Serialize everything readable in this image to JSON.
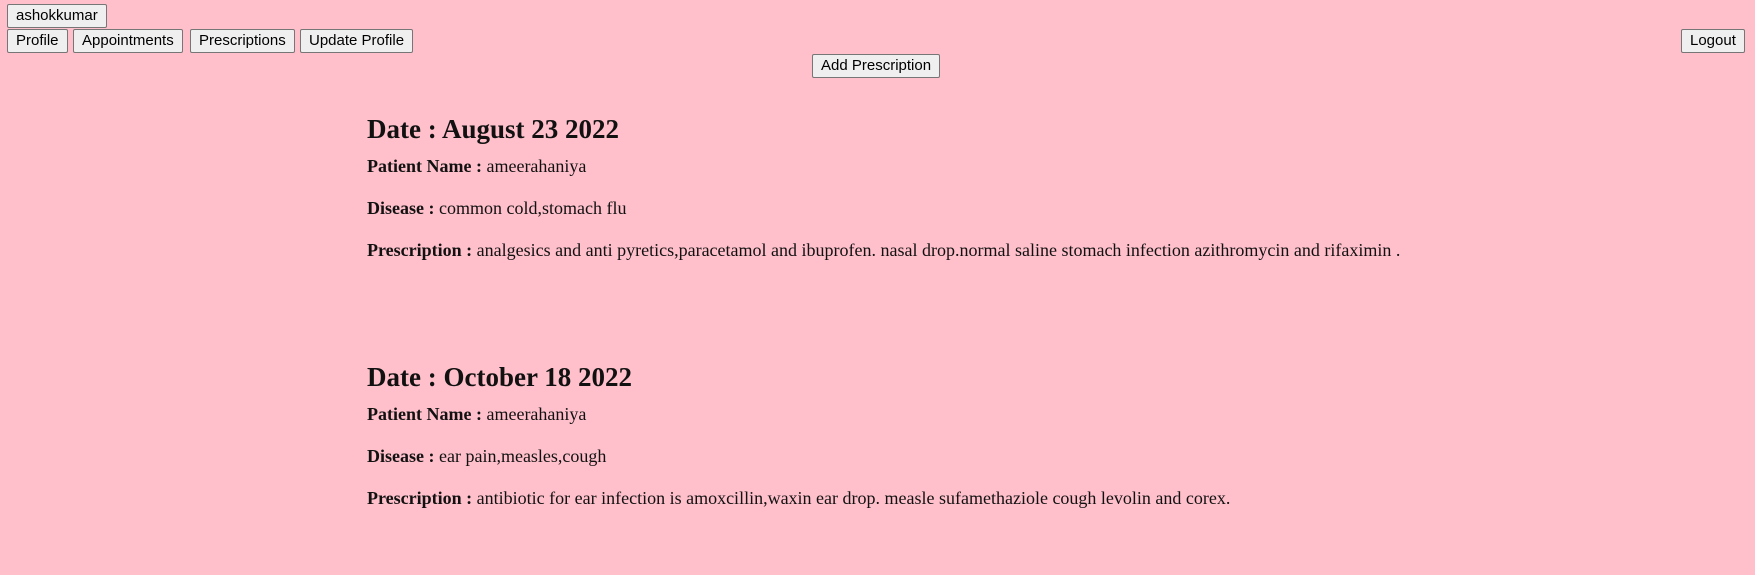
{
  "header": {
    "username": "ashokkumar",
    "nav": [
      {
        "label": "Profile"
      },
      {
        "label": "Appointments"
      },
      {
        "label": "Prescriptions"
      },
      {
        "label": "Update Profile"
      }
    ],
    "logout_label": "Logout"
  },
  "toolbar": {
    "add_label": "Add Prescription"
  },
  "labels": {
    "patient": "Patient Name :",
    "disease": "Disease :",
    "prescription": "Prescription :"
  },
  "prescriptions": [
    {
      "date_heading": "Date : August 23 2022",
      "patient": "ameerahaniya",
      "disease": "common cold,stomach flu",
      "prescription": "analgesics and anti pyretics,paracetamol and ibuprofen. nasal drop.normal saline stomach infection azithromycin and rifaximin ."
    },
    {
      "date_heading": "Date : October 18 2022",
      "patient": "ameerahaniya",
      "disease": "ear pain,measles,cough",
      "prescription": "antibiotic for ear infection is amoxcillin,waxin ear drop. measle sufamethaziole cough levolin and corex."
    }
  ]
}
